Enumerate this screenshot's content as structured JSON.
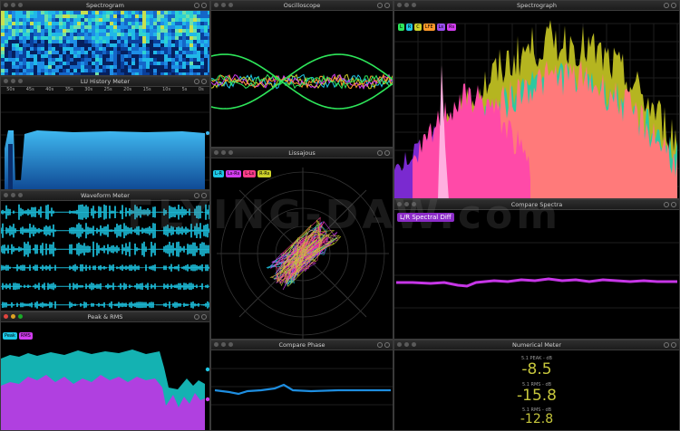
{
  "panels": {
    "spectrogram": {
      "title": "Spectrogram"
    },
    "lu_history": {
      "title": "LU History Meter",
      "ticks": [
        "50s",
        "45s",
        "40s",
        "35s",
        "30s",
        "25s",
        "20s",
        "15s",
        "10s",
        "5s",
        "0s"
      ]
    },
    "waveform": {
      "title": "Waveform Meter"
    },
    "peak_rms": {
      "title": "Peak & RMS",
      "tags": [
        "Peak",
        "RMS"
      ]
    },
    "oscilloscope": {
      "title": "Oscilloscope"
    },
    "lissajous": {
      "title": "Lissajous",
      "tags": [
        "L-R",
        "Ls-Rs",
        "L-Ls",
        "R-Rs"
      ]
    },
    "compare_phase": {
      "title": "Compare Phase"
    },
    "spectrograph": {
      "title": "Spectrograph",
      "tags": [
        "L",
        "R",
        "C",
        "LFE",
        "Ls",
        "Rs"
      ]
    },
    "compare_spectra": {
      "title": "Compare Spectra",
      "badge": "L/R Spectral Diff"
    },
    "numerical_meter": {
      "title": "Numerical Meter",
      "rows": [
        {
          "label": "5.1 PEAK - dB",
          "value": "-8.5"
        },
        {
          "label": "5.1 RMS - dB",
          "value": "-15.8"
        },
        {
          "label": "5.1 RMS - dB",
          "value": "-12.8"
        }
      ]
    }
  },
  "watermark": "FLYING-DAW.com",
  "colors": {
    "cyan": "#1ec8e6",
    "magenta": "#d23cf0",
    "yellow": "#cdd22a",
    "pink": "#ff5ab0",
    "green": "#2ee65a"
  }
}
